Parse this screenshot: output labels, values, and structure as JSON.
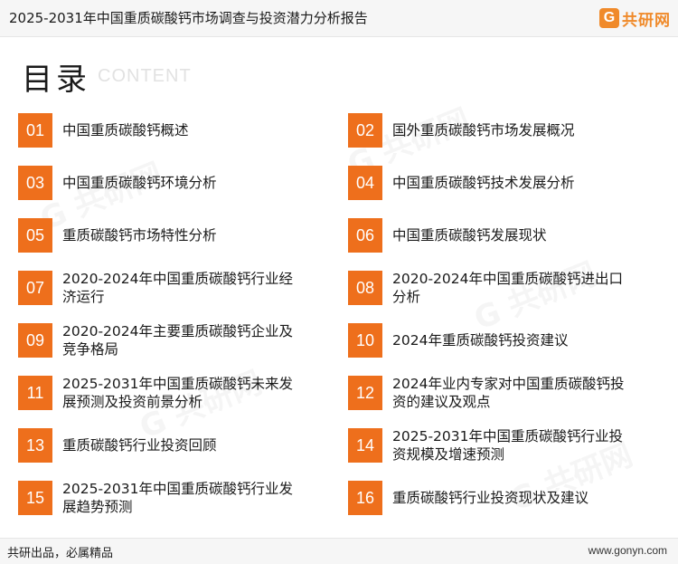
{
  "header": {
    "title": "2025-2031年中国重质碳酸钙市场调查与投资潜力分析报告",
    "logo_text": "共研网"
  },
  "section": {
    "title": "目录",
    "subtitle": "CONTENT"
  },
  "items": [
    {
      "num": "01",
      "label": "中国重质碳酸钙概述"
    },
    {
      "num": "02",
      "label": "国外重质碳酸钙市场发展概况"
    },
    {
      "num": "03",
      "label": "中国重质碳酸钙环境分析"
    },
    {
      "num": "04",
      "label": "中国重质碳酸钙技术发展分析"
    },
    {
      "num": "05",
      "label": "重质碳酸钙市场特性分析"
    },
    {
      "num": "06",
      "label": "中国重质碳酸钙发展现状"
    },
    {
      "num": "07",
      "label": "2020-2024年中国重质碳酸钙行业经济运行"
    },
    {
      "num": "08",
      "label": "2020-2024年中国重质碳酸钙进出口分析"
    },
    {
      "num": "09",
      "label": "2020-2024年主要重质碳酸钙企业及竞争格局"
    },
    {
      "num": "10",
      "label": "2024年重质碳酸钙投资建议"
    },
    {
      "num": "11",
      "label": "2025-2031年中国重质碳酸钙未来发展预测及投资前景分析"
    },
    {
      "num": "12",
      "label": "2024年业内专家对中国重质碳酸钙投资的建议及观点"
    },
    {
      "num": "13",
      "label": "重质碳酸钙行业投资回顾"
    },
    {
      "num": "14",
      "label": "2025-2031年中国重质碳酸钙行业投资规模及增速预测"
    },
    {
      "num": "15",
      "label": "2025-2031年中国重质碳酸钙行业发展趋势预测"
    },
    {
      "num": "16",
      "label": "重质碳酸钙行业投资现状及建议"
    }
  ],
  "footer": {
    "slogan": "共研出品，必属精品",
    "url": "www.gonyn.com"
  },
  "colors": {
    "accent": "#ee6f1c",
    "brand": "#f08a2a"
  },
  "icons": {
    "logo": "gonyn-logo-icon"
  }
}
